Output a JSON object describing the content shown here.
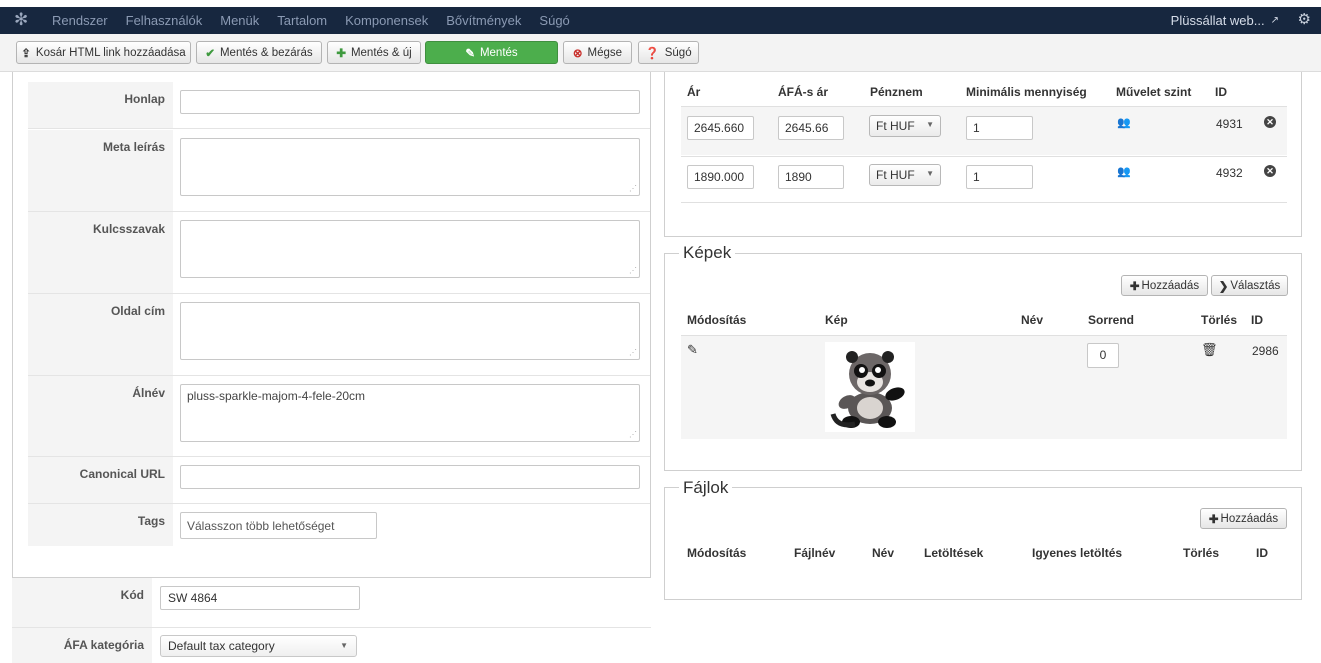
{
  "navbar": {
    "menu": [
      "Rendszer",
      "Felhasználók",
      "Menük",
      "Tartalom",
      "Komponensek",
      "Bővítmények",
      "Súgó"
    ],
    "site_name": "Plüssállat web..."
  },
  "toolbar": {
    "cart_link": "Kosár HTML link hozzáadása",
    "save_close": "Mentés & bezárás",
    "save_new": "Mentés & új",
    "save": "Mentés",
    "cancel": "Mégse",
    "help": "Súgó"
  },
  "form": {
    "homepage_label": "Honlap",
    "meta_desc_label": "Meta leírás",
    "keywords_label": "Kulcsszavak",
    "page_title_label": "Oldal cím",
    "alias_label": "Álnév",
    "alias_value": "pluss-sparkle-majom-4-fele-20cm",
    "canonical_label": "Canonical URL",
    "tags_label": "Tags",
    "tags_placeholder": "Válasszon több lehetőséget",
    "code_label": "Kód",
    "code_value": "SW 4864",
    "vat_label": "ÁFA kategória",
    "vat_value": "Default tax category"
  },
  "prices": {
    "headers": {
      "price": "Ár",
      "gross": "ÁFÁ-s ár",
      "currency": "Pénznem",
      "min_qty": "Minimális mennyiség",
      "op_level": "Művelet szint",
      "id": "ID"
    },
    "rows": [
      {
        "price": "2645.660",
        "gross": "2645.66",
        "currency": "Ft HUF",
        "min_qty": "1",
        "id": "4931"
      },
      {
        "price": "1890.000",
        "gross": "1890",
        "currency": "Ft HUF",
        "min_qty": "1",
        "id": "4932"
      }
    ]
  },
  "images": {
    "legend": "Képek",
    "add": "Hozzáadás",
    "choose": "Választás",
    "headers": {
      "edit": "Módosítás",
      "image": "Kép",
      "name": "Név",
      "order": "Sorrend",
      "delete": "Törlés",
      "id": "ID"
    },
    "rows": [
      {
        "order": "0",
        "id": "2986"
      }
    ]
  },
  "files": {
    "legend": "Fájlok",
    "add": "Hozzáadás",
    "headers": {
      "edit": "Módosítás",
      "filename": "Fájlnév",
      "name": "Név",
      "downloads": "Letöltések",
      "free": "Igyenes letöltés",
      "delete": "Törlés",
      "id": "ID"
    }
  }
}
